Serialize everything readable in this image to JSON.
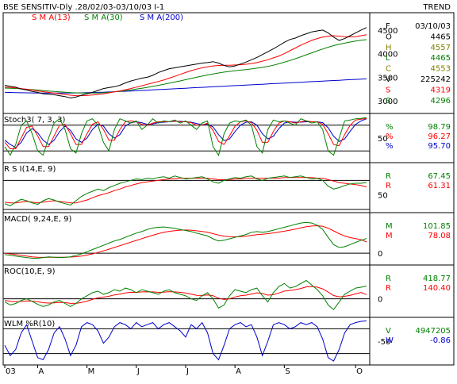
{
  "header": {
    "title": "BSE SENSITIV-Dly .28/02/03-03/10/03  I-1",
    "right": "TREND"
  },
  "colors": {
    "price": "#000000",
    "red": "#ff0000",
    "green": "#008000",
    "blue": "#0000cc",
    "frame": "#000000"
  },
  "chart_data": [
    {
      "type": "line",
      "panel": "price",
      "legend": [
        "S M A(13)",
        "S M A(30)",
        "S M A(200)"
      ],
      "ylim": [
        2800,
        4800
      ],
      "yticks": [
        3000,
        3500,
        4000,
        4500
      ],
      "info": [
        {
          "k": "F",
          "v": "03/10/03",
          "color": "#000000"
        },
        {
          "k": "O",
          "v": "4465",
          "color": "#000000"
        },
        {
          "k": "H",
          "v": "4557",
          "color": "#808000"
        },
        {
          "k": "L",
          "v": "4465",
          "color": "#008000"
        },
        {
          "k": "C",
          "v": "4553",
          "color": "#808000"
        },
        {
          "k": "V",
          "v": "225242",
          "color": "#000000"
        },
        {
          "k": "S",
          "v": "4319",
          "color": "#ff0000"
        },
        {
          "k": "S",
          "v": "4296",
          "color": "#008000"
        }
      ],
      "close": [
        3330,
        3310,
        3290,
        3250,
        3230,
        3200,
        3180,
        3150,
        3140,
        3130,
        3110,
        3090,
        3060,
        3080,
        3120,
        3150,
        3180,
        3220,
        3260,
        3280,
        3300,
        3330,
        3380,
        3420,
        3450,
        3480,
        3500,
        3540,
        3600,
        3640,
        3680,
        3700,
        3720,
        3740,
        3760,
        3780,
        3800,
        3810,
        3830,
        3800,
        3750,
        3720,
        3740,
        3780,
        3820,
        3870,
        3920,
        3980,
        4040,
        4100,
        4170,
        4240,
        4300,
        4330,
        4380,
        4420,
        4460,
        4480,
        4500,
        4440,
        4350,
        4280,
        4320,
        4380,
        4440,
        4500,
        4553
      ],
      "sma13": [
        3290,
        3285,
        3275,
        3260,
        3245,
        3230,
        3210,
        3195,
        3180,
        3165,
        3150,
        3135,
        3120,
        3110,
        3110,
        3115,
        3125,
        3135,
        3150,
        3170,
        3190,
        3210,
        3235,
        3260,
        3290,
        3320,
        3350,
        3380,
        3410,
        3440,
        3480,
        3520,
        3560,
        3600,
        3640,
        3670,
        3700,
        3720,
        3740,
        3750,
        3755,
        3755,
        3760,
        3765,
        3775,
        3790,
        3810,
        3840,
        3870,
        3910,
        3950,
        4000,
        4060,
        4120,
        4180,
        4230,
        4280,
        4320,
        4350,
        4370,
        4380,
        4370,
        4360,
        4355,
        4360,
        4380,
        4400
      ],
      "sma30": [
        3270,
        3268,
        3262,
        3254,
        3246,
        3238,
        3228,
        3218,
        3208,
        3198,
        3190,
        3182,
        3175,
        3170,
        3166,
        3164,
        3165,
        3167,
        3172,
        3180,
        3190,
        3202,
        3215,
        3230,
        3248,
        3266,
        3286,
        3306,
        3328,
        3350,
        3374,
        3398,
        3422,
        3448,
        3474,
        3500,
        3524,
        3548,
        3570,
        3590,
        3608,
        3624,
        3638,
        3650,
        3662,
        3676,
        3692,
        3710,
        3730,
        3755,
        3785,
        3818,
        3854,
        3892,
        3932,
        3974,
        4016,
        4058,
        4098,
        4136,
        4170,
        4198,
        4222,
        4246,
        4268,
        4286,
        4296
      ],
      "sma200": [
        3180,
        3178,
        3175,
        3172,
        3170,
        3168,
        3166,
        3165,
        3164,
        3164,
        3164,
        3165,
        3166,
        3168,
        3170,
        3173,
        3176,
        3180,
        3184,
        3188,
        3193,
        3198,
        3203,
        3208,
        3214,
        3220,
        3226,
        3232,
        3238,
        3244,
        3250,
        3256,
        3262,
        3268,
        3274,
        3280,
        3286,
        3292,
        3298,
        3304,
        3310,
        3316,
        3322,
        3328,
        3334,
        3340,
        3346,
        3352,
        3358,
        3364,
        3370,
        3376,
        3382,
        3388,
        3394,
        3400,
        3406,
        3412,
        3418,
        3424,
        3430,
        3436,
        3442,
        3448,
        3454,
        3460,
        3466
      ]
    },
    {
      "type": "line",
      "panel": "stoch",
      "title": "Stoch3( 7, 3, 3)",
      "ylim": [
        0,
        100
      ],
      "yticks": [
        50
      ],
      "refs": [
        20,
        80
      ],
      "info": [
        {
          "k": "%",
          "v": "98.79",
          "color": "#008000"
        },
        {
          "k": "%",
          "v": "96.27",
          "color": "#ff0000"
        },
        {
          "k": "%",
          "v": "95.70",
          "color": "#0000cc"
        }
      ],
      "k": [
        30,
        10,
        35,
        80,
        90,
        60,
        20,
        10,
        50,
        85,
        95,
        70,
        25,
        15,
        60,
        90,
        95,
        80,
        40,
        20,
        70,
        95,
        90,
        85,
        90,
        70,
        80,
        95,
        85,
        90,
        88,
        92,
        85,
        90,
        80,
        70,
        85,
        90,
        30,
        10,
        60,
        85,
        90,
        88,
        92,
        80,
        30,
        15,
        70,
        92,
        88,
        90,
        85,
        80,
        95,
        90,
        85,
        88,
        70,
        20,
        10,
        50,
        90,
        92,
        95,
        96,
        98
      ],
      "d": [
        40,
        25,
        25,
        50,
        75,
        78,
        55,
        30,
        30,
        55,
        80,
        82,
        60,
        35,
        35,
        60,
        82,
        88,
        70,
        45,
        45,
        70,
        88,
        90,
        88,
        82,
        80,
        85,
        88,
        88,
        88,
        90,
        88,
        88,
        86,
        80,
        80,
        85,
        68,
        42,
        35,
        55,
        78,
        88,
        90,
        86,
        68,
        40,
        40,
        65,
        85,
        90,
        88,
        85,
        88,
        90,
        88,
        88,
        82,
        60,
        35,
        32,
        58,
        80,
        92,
        94,
        96
      ],
      "s": [
        45,
        35,
        28,
        40,
        62,
        72,
        62,
        45,
        35,
        45,
        65,
        78,
        68,
        48,
        40,
        50,
        70,
        82,
        78,
        60,
        50,
        58,
        78,
        86,
        88,
        86,
        82,
        83,
        86,
        87,
        88,
        89,
        89,
        88,
        87,
        84,
        81,
        83,
        76,
        58,
        44,
        48,
        65,
        80,
        87,
        88,
        80,
        60,
        48,
        54,
        72,
        85,
        88,
        87,
        87,
        88,
        88,
        88,
        86,
        74,
        54,
        42,
        48,
        66,
        82,
        90,
        95
      ]
    },
    {
      "type": "line",
      "panel": "rsi",
      "title": "R S I(14,E, 9)",
      "ylim": [
        30,
        90
      ],
      "yticks": [
        50
      ],
      "refs": [
        70,
        30
      ],
      "info": [
        {
          "k": "R",
          "v": "67.45",
          "color": "#008000"
        },
        {
          "k": "R",
          "v": "61.31",
          "color": "#ff0000"
        }
      ],
      "rsi": [
        38,
        35,
        40,
        44,
        42,
        39,
        37,
        42,
        45,
        43,
        40,
        38,
        36,
        42,
        48,
        52,
        55,
        58,
        56,
        60,
        63,
        66,
        68,
        70,
        72,
        71,
        73,
        72,
        74,
        75,
        73,
        76,
        74,
        72,
        73,
        74,
        75,
        72,
        68,
        66,
        70,
        72,
        74,
        73,
        75,
        76,
        72,
        70,
        73,
        74,
        75,
        76,
        74,
        75,
        76,
        74,
        72,
        73,
        70,
        62,
        58,
        60,
        63,
        65,
        66,
        66,
        67
      ],
      "signal": [
        40,
        39,
        39,
        40,
        41,
        40,
        39,
        40,
        41,
        42,
        41,
        40,
        39,
        39,
        41,
        43,
        46,
        49,
        51,
        53,
        56,
        58,
        61,
        63,
        65,
        67,
        68,
        69,
        70,
        71,
        72,
        72,
        73,
        73,
        73,
        73,
        73,
        73,
        72,
        71,
        71,
        71,
        72,
        72,
        73,
        73,
        73,
        73,
        73,
        73,
        73,
        74,
        74,
        74,
        74,
        74,
        74,
        73,
        73,
        71,
        69,
        67,
        66,
        65,
        64,
        63,
        61
      ]
    },
    {
      "type": "line",
      "panel": "macd",
      "title": "MACD( 9,24,E, 9)",
      "ylim": [
        -60,
        260
      ],
      "yticks": [
        0
      ],
      "refs": [
        0
      ],
      "info": [
        {
          "k": "M",
          "v": "101.85",
          "color": "#008000"
        },
        {
          "k": "M",
          "v": "78.08",
          "color": "#ff0000"
        }
      ],
      "macd": [
        -10,
        -15,
        -20,
        -25,
        -30,
        -35,
        -35,
        -30,
        -25,
        -28,
        -30,
        -28,
        -25,
        -15,
        -5,
        10,
        25,
        40,
        55,
        70,
        85,
        95,
        110,
        125,
        140,
        150,
        165,
        175,
        180,
        182,
        178,
        172,
        165,
        158,
        150,
        140,
        130,
        120,
        100,
        85,
        90,
        100,
        110,
        120,
        130,
        145,
        150,
        145,
        150,
        160,
        170,
        180,
        190,
        200,
        210,
        215,
        210,
        195,
        165,
        110,
        60,
        40,
        45,
        60,
        75,
        90,
        102
      ],
      "signal": [
        0,
        -5,
        -10,
        -15,
        -20,
        -25,
        -28,
        -29,
        -28,
        -28,
        -28,
        -28,
        -27,
        -24,
        -20,
        -13,
        -5,
        5,
        16,
        28,
        40,
        52,
        64,
        77,
        89,
        101,
        113,
        125,
        136,
        145,
        152,
        157,
        160,
        161,
        160,
        156,
        151,
        145,
        136,
        126,
        119,
        115,
        114,
        115,
        118,
        124,
        129,
        132,
        136,
        141,
        147,
        153,
        160,
        168,
        176,
        184,
        189,
        191,
        187,
        174,
        155,
        136,
        120,
        109,
        101,
        94,
        78
      ]
    },
    {
      "type": "line",
      "panel": "roc",
      "title": "ROC(10,E, 9)",
      "ylim": [
        -500,
        1000
      ],
      "yticks": [
        0
      ],
      "refs": [
        0
      ],
      "info": [
        {
          "k": "R",
          "v": "418.77",
          "color": "#008000"
        },
        {
          "k": "R",
          "v": "140.40",
          "color": "#ff0000"
        }
      ],
      "roc": [
        -100,
        -200,
        -150,
        -50,
        0,
        -80,
        -180,
        -250,
        -200,
        -100,
        -50,
        -150,
        -250,
        -150,
        0,
        100,
        200,
        250,
        150,
        200,
        300,
        250,
        350,
        300,
        200,
        300,
        250,
        200,
        150,
        250,
        300,
        200,
        150,
        100,
        0,
        -50,
        100,
        200,
        0,
        -300,
        -200,
        100,
        300,
        250,
        200,
        300,
        350,
        100,
        -100,
        200,
        400,
        500,
        350,
        400,
        500,
        600,
        450,
        300,
        100,
        -200,
        -350,
        -100,
        150,
        250,
        350,
        380,
        419
      ],
      "signal": [
        -50,
        -80,
        -95,
        -85,
        -70,
        -72,
        -92,
        -124,
        -139,
        -131,
        -115,
        -122,
        -148,
        -148,
        -118,
        -75,
        -20,
        34,
        57,
        85,
        128,
        152,
        191,
        213,
        210,
        228,
        233,
        226,
        211,
        219,
        235,
        228,
        212,
        190,
        152,
        112,
        110,
        128,
        102,
        22,
        -22,
        2,
        62,
        100,
        120,
        156,
        195,
        176,
        121,
        137,
        190,
        252,
        272,
        298,
        338,
        390,
        402,
        382,
        326,
        221,
        107,
        66,
        83,
        116,
        163,
        206,
        140
      ]
    },
    {
      "type": "line",
      "panel": "wlm",
      "title": "WLM %R(10)",
      "ylim": [
        -100,
        0
      ],
      "yticks": [
        -50
      ],
      "refs": [
        -20,
        -80
      ],
      "info": [
        {
          "k": "V",
          "v": "4947205",
          "color": "#008000"
        },
        {
          "k": "W",
          "v": "-0.86",
          "color": "#0000cc"
        }
      ],
      "wr": [
        -60,
        -85,
        -70,
        -30,
        -10,
        -50,
        -90,
        -95,
        -70,
        -30,
        -15,
        -45,
        -85,
        -60,
        -15,
        -5,
        -10,
        -25,
        -55,
        -40,
        -15,
        -5,
        -10,
        -20,
        -5,
        -15,
        -10,
        -5,
        -20,
        -10,
        -5,
        -15,
        -25,
        -40,
        -10,
        -20,
        -5,
        -30,
        -80,
        -95,
        -60,
        -20,
        -10,
        -5,
        -15,
        -10,
        -40,
        -85,
        -50,
        -10,
        -5,
        -10,
        -20,
        -15,
        -5,
        -10,
        -5,
        -15,
        -45,
        -90,
        -98,
        -70,
        -30,
        -10,
        -5,
        -2,
        -1
      ]
    }
  ],
  "xaxis": {
    "labels": [
      "03",
      "A",
      "M",
      "J",
      "J",
      "A",
      "S",
      "O"
    ],
    "idx": [
      0,
      6,
      15,
      24,
      33,
      42,
      51,
      64
    ]
  }
}
